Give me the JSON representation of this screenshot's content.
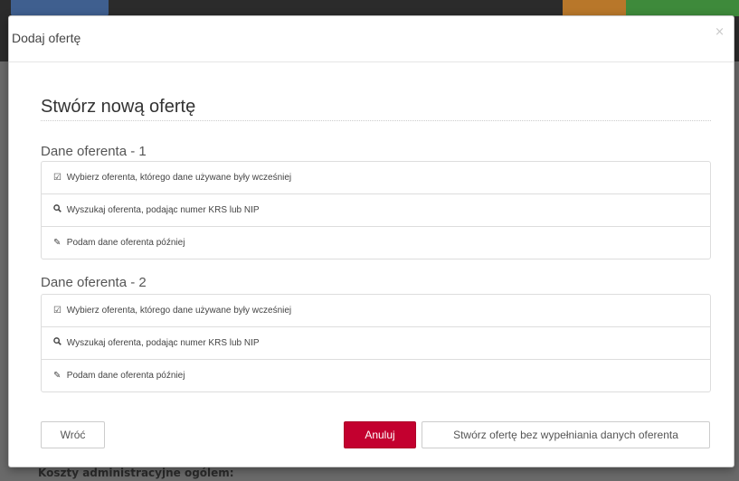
{
  "background": {
    "footer_text": "Koszty administracyjne ogólem:"
  },
  "modal": {
    "title": "Dodaj ofertę",
    "close_label": "×",
    "heading": "Stwórz nową ofertę"
  },
  "groups": [
    {
      "title": "Dane oferenta - 1",
      "options": [
        {
          "icon": "checkbox-icon",
          "glyph": "☑",
          "label": "Wybierz oferenta, którego dane używane były wcześniej"
        },
        {
          "icon": "search-icon",
          "glyph": "🔍",
          "label": "Wyszukaj oferenta, podając numer KRS lub NIP"
        },
        {
          "icon": "edit-icon",
          "glyph": "✎",
          "label": "Podam dane oferenta później"
        }
      ]
    },
    {
      "title": "Dane oferenta - 2",
      "options": [
        {
          "icon": "checkbox-icon",
          "glyph": "☑",
          "label": "Wybierz oferenta, którego dane używane były wcześniej"
        },
        {
          "icon": "search-icon",
          "glyph": "🔍",
          "label": "Wyszukaj oferenta, podając numer KRS lub NIP"
        },
        {
          "icon": "edit-icon",
          "glyph": "✎",
          "label": "Podam dane oferenta później"
        }
      ]
    }
  ],
  "footer": {
    "back_label": "Wróć",
    "cancel_label": "Anuluj",
    "create_label": "Stwórz ofertę bez wypełniania danych oferenta"
  },
  "colors": {
    "cancel_bg": "#c3002f"
  }
}
